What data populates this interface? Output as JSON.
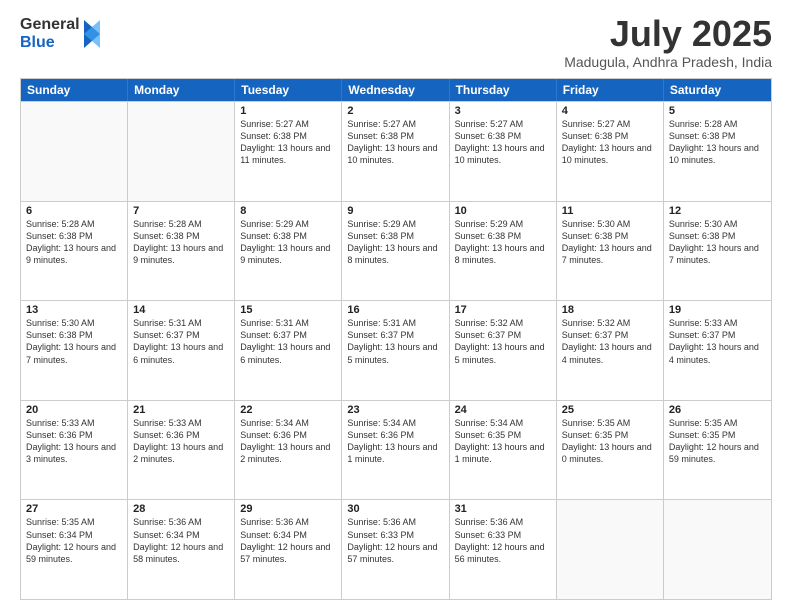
{
  "logo": {
    "general": "General",
    "blue": "Blue"
  },
  "title": "July 2025",
  "location": "Madugula, Andhra Pradesh, India",
  "header_days": [
    "Sunday",
    "Monday",
    "Tuesday",
    "Wednesday",
    "Thursday",
    "Friday",
    "Saturday"
  ],
  "weeks": [
    [
      {
        "day": "",
        "sunrise": "",
        "sunset": "",
        "daylight": ""
      },
      {
        "day": "",
        "sunrise": "",
        "sunset": "",
        "daylight": ""
      },
      {
        "day": "1",
        "sunrise": "Sunrise: 5:27 AM",
        "sunset": "Sunset: 6:38 PM",
        "daylight": "Daylight: 13 hours and 11 minutes."
      },
      {
        "day": "2",
        "sunrise": "Sunrise: 5:27 AM",
        "sunset": "Sunset: 6:38 PM",
        "daylight": "Daylight: 13 hours and 10 minutes."
      },
      {
        "day": "3",
        "sunrise": "Sunrise: 5:27 AM",
        "sunset": "Sunset: 6:38 PM",
        "daylight": "Daylight: 13 hours and 10 minutes."
      },
      {
        "day": "4",
        "sunrise": "Sunrise: 5:27 AM",
        "sunset": "Sunset: 6:38 PM",
        "daylight": "Daylight: 13 hours and 10 minutes."
      },
      {
        "day": "5",
        "sunrise": "Sunrise: 5:28 AM",
        "sunset": "Sunset: 6:38 PM",
        "daylight": "Daylight: 13 hours and 10 minutes."
      }
    ],
    [
      {
        "day": "6",
        "sunrise": "Sunrise: 5:28 AM",
        "sunset": "Sunset: 6:38 PM",
        "daylight": "Daylight: 13 hours and 9 minutes."
      },
      {
        "day": "7",
        "sunrise": "Sunrise: 5:28 AM",
        "sunset": "Sunset: 6:38 PM",
        "daylight": "Daylight: 13 hours and 9 minutes."
      },
      {
        "day": "8",
        "sunrise": "Sunrise: 5:29 AM",
        "sunset": "Sunset: 6:38 PM",
        "daylight": "Daylight: 13 hours and 9 minutes."
      },
      {
        "day": "9",
        "sunrise": "Sunrise: 5:29 AM",
        "sunset": "Sunset: 6:38 PM",
        "daylight": "Daylight: 13 hours and 8 minutes."
      },
      {
        "day": "10",
        "sunrise": "Sunrise: 5:29 AM",
        "sunset": "Sunset: 6:38 PM",
        "daylight": "Daylight: 13 hours and 8 minutes."
      },
      {
        "day": "11",
        "sunrise": "Sunrise: 5:30 AM",
        "sunset": "Sunset: 6:38 PM",
        "daylight": "Daylight: 13 hours and 7 minutes."
      },
      {
        "day": "12",
        "sunrise": "Sunrise: 5:30 AM",
        "sunset": "Sunset: 6:38 PM",
        "daylight": "Daylight: 13 hours and 7 minutes."
      }
    ],
    [
      {
        "day": "13",
        "sunrise": "Sunrise: 5:30 AM",
        "sunset": "Sunset: 6:38 PM",
        "daylight": "Daylight: 13 hours and 7 minutes."
      },
      {
        "day": "14",
        "sunrise": "Sunrise: 5:31 AM",
        "sunset": "Sunset: 6:37 PM",
        "daylight": "Daylight: 13 hours and 6 minutes."
      },
      {
        "day": "15",
        "sunrise": "Sunrise: 5:31 AM",
        "sunset": "Sunset: 6:37 PM",
        "daylight": "Daylight: 13 hours and 6 minutes."
      },
      {
        "day": "16",
        "sunrise": "Sunrise: 5:31 AM",
        "sunset": "Sunset: 6:37 PM",
        "daylight": "Daylight: 13 hours and 5 minutes."
      },
      {
        "day": "17",
        "sunrise": "Sunrise: 5:32 AM",
        "sunset": "Sunset: 6:37 PM",
        "daylight": "Daylight: 13 hours and 5 minutes."
      },
      {
        "day": "18",
        "sunrise": "Sunrise: 5:32 AM",
        "sunset": "Sunset: 6:37 PM",
        "daylight": "Daylight: 13 hours and 4 minutes."
      },
      {
        "day": "19",
        "sunrise": "Sunrise: 5:33 AM",
        "sunset": "Sunset: 6:37 PM",
        "daylight": "Daylight: 13 hours and 4 minutes."
      }
    ],
    [
      {
        "day": "20",
        "sunrise": "Sunrise: 5:33 AM",
        "sunset": "Sunset: 6:36 PM",
        "daylight": "Daylight: 13 hours and 3 minutes."
      },
      {
        "day": "21",
        "sunrise": "Sunrise: 5:33 AM",
        "sunset": "Sunset: 6:36 PM",
        "daylight": "Daylight: 13 hours and 2 minutes."
      },
      {
        "day": "22",
        "sunrise": "Sunrise: 5:34 AM",
        "sunset": "Sunset: 6:36 PM",
        "daylight": "Daylight: 13 hours and 2 minutes."
      },
      {
        "day": "23",
        "sunrise": "Sunrise: 5:34 AM",
        "sunset": "Sunset: 6:36 PM",
        "daylight": "Daylight: 13 hours and 1 minute."
      },
      {
        "day": "24",
        "sunrise": "Sunrise: 5:34 AM",
        "sunset": "Sunset: 6:35 PM",
        "daylight": "Daylight: 13 hours and 1 minute."
      },
      {
        "day": "25",
        "sunrise": "Sunrise: 5:35 AM",
        "sunset": "Sunset: 6:35 PM",
        "daylight": "Daylight: 13 hours and 0 minutes."
      },
      {
        "day": "26",
        "sunrise": "Sunrise: 5:35 AM",
        "sunset": "Sunset: 6:35 PM",
        "daylight": "Daylight: 12 hours and 59 minutes."
      }
    ],
    [
      {
        "day": "27",
        "sunrise": "Sunrise: 5:35 AM",
        "sunset": "Sunset: 6:34 PM",
        "daylight": "Daylight: 12 hours and 59 minutes."
      },
      {
        "day": "28",
        "sunrise": "Sunrise: 5:36 AM",
        "sunset": "Sunset: 6:34 PM",
        "daylight": "Daylight: 12 hours and 58 minutes."
      },
      {
        "day": "29",
        "sunrise": "Sunrise: 5:36 AM",
        "sunset": "Sunset: 6:34 PM",
        "daylight": "Daylight: 12 hours and 57 minutes."
      },
      {
        "day": "30",
        "sunrise": "Sunrise: 5:36 AM",
        "sunset": "Sunset: 6:33 PM",
        "daylight": "Daylight: 12 hours and 57 minutes."
      },
      {
        "day": "31",
        "sunrise": "Sunrise: 5:36 AM",
        "sunset": "Sunset: 6:33 PM",
        "daylight": "Daylight: 12 hours and 56 minutes."
      },
      {
        "day": "",
        "sunrise": "",
        "sunset": "",
        "daylight": ""
      },
      {
        "day": "",
        "sunrise": "",
        "sunset": "",
        "daylight": ""
      }
    ]
  ]
}
